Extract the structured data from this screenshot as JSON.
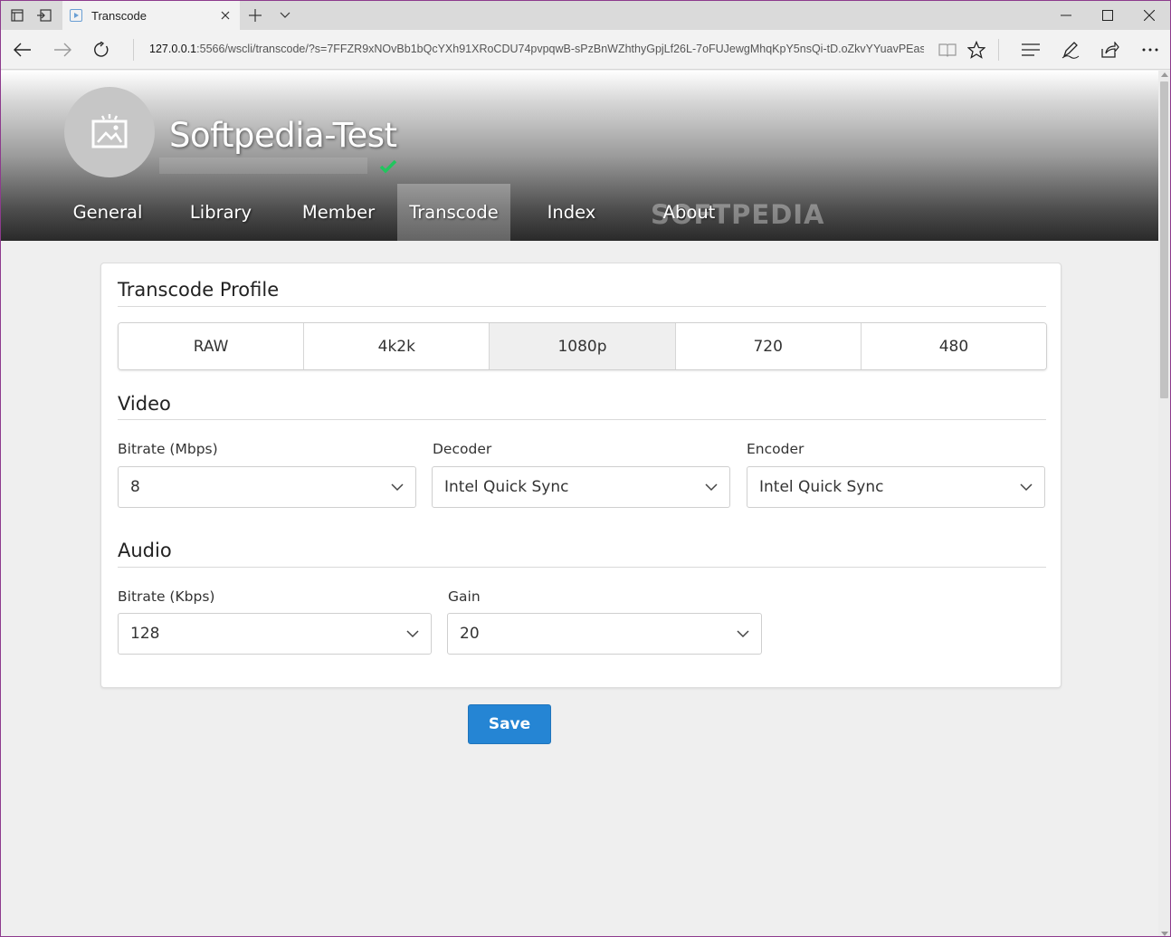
{
  "browser": {
    "tab_title": "Transcode",
    "url_host": "127.0.0.1",
    "url_rest": ":5566/wscli/transcode/?s=7FFZR9xNOvBb1bQcYXh91XRoCDU74pvpqwB-sPzBnWZhthyGpjLf26L-7oFUJewgMhqKpY5nsQi-tD.oZkvYYuavPEas"
  },
  "header": {
    "server_name": "Softpedia-Test",
    "watermark": "SOFTPEDIA",
    "nav_tabs": [
      {
        "label": "General"
      },
      {
        "label": "Library"
      },
      {
        "label": "Member"
      },
      {
        "label": "Transcode",
        "active": true
      },
      {
        "label": "Index"
      },
      {
        "label": "About"
      }
    ]
  },
  "transcode": {
    "profile_title": "Transcode Profile",
    "profiles": [
      {
        "label": "RAW"
      },
      {
        "label": "4k2k"
      },
      {
        "label": "1080p",
        "selected": true
      },
      {
        "label": "720"
      },
      {
        "label": "480"
      }
    ],
    "video": {
      "title": "Video",
      "bitrate_label": "Bitrate (Mbps)",
      "bitrate_value": "8",
      "decoder_label": "Decoder",
      "decoder_value": "Intel Quick Sync",
      "encoder_label": "Encoder",
      "encoder_value": "Intel Quick Sync"
    },
    "audio": {
      "title": "Audio",
      "bitrate_label": "Bitrate (Kbps)",
      "bitrate_value": "128",
      "gain_label": "Gain",
      "gain_value": "20"
    },
    "save_label": "Save"
  },
  "colors": {
    "accent": "#2585d4",
    "status_ok": "#22c55e",
    "frame": "#8d3b8d"
  }
}
